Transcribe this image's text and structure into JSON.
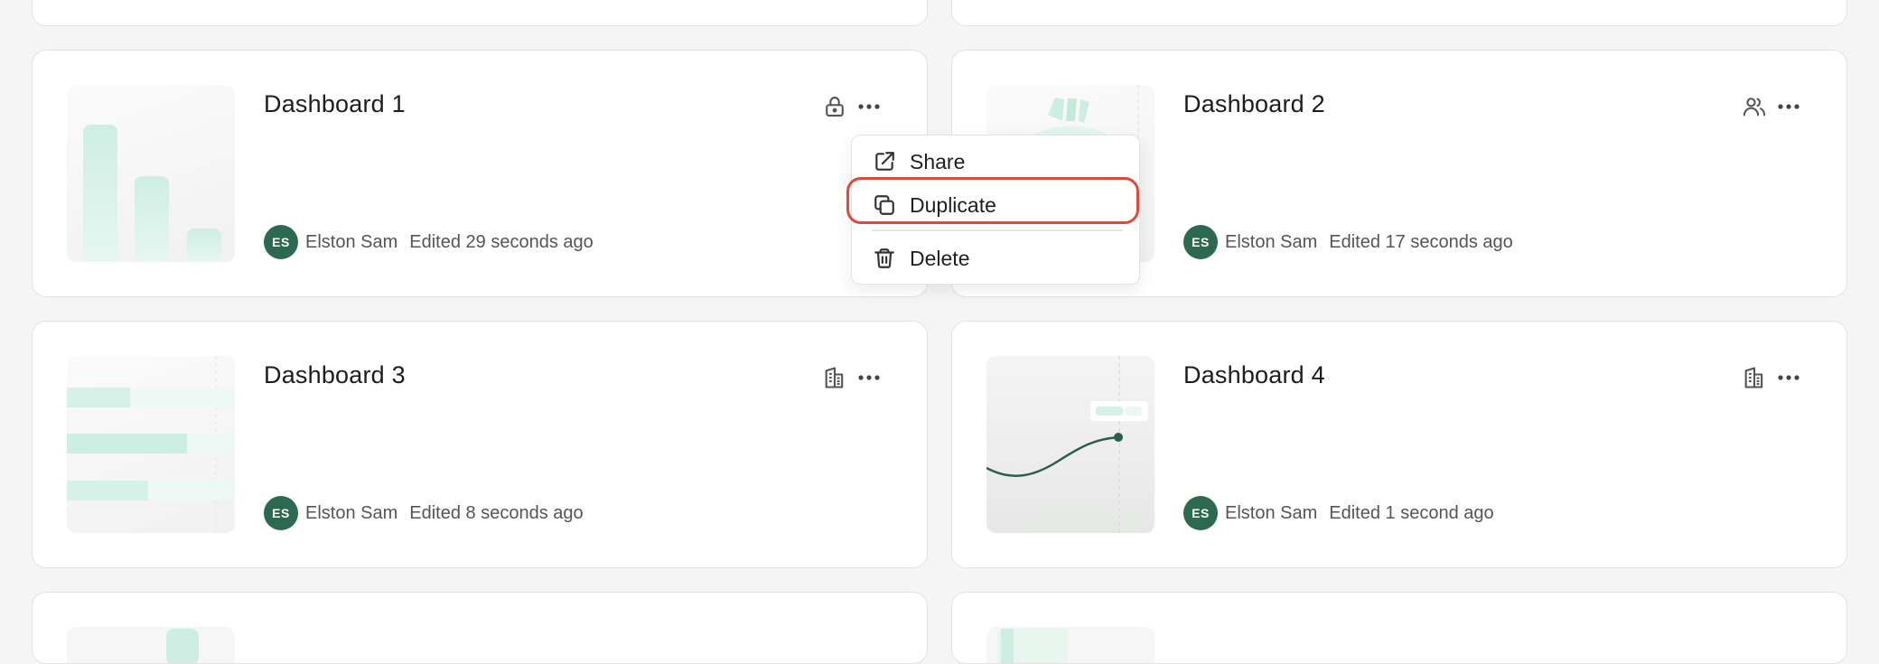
{
  "cards": [
    {
      "title": "Dashboard 1",
      "avatar_initials": "ES",
      "owner": "Elston Sam",
      "edited": "Edited 29 seconds ago",
      "status_icon": "lock-icon"
    },
    {
      "title": "Dashboard 2",
      "avatar_initials": "ES",
      "owner": "Elston Sam",
      "edited": "Edited 17 seconds ago",
      "status_icon": "users-icon"
    },
    {
      "title": "Dashboard 3",
      "avatar_initials": "ES",
      "owner": "Elston Sam",
      "edited": "Edited 8 seconds ago",
      "status_icon": "building-icon"
    },
    {
      "title": "Dashboard 4",
      "avatar_initials": "ES",
      "owner": "Elston Sam",
      "edited": "Edited 1 second ago",
      "status_icon": "building-icon"
    }
  ],
  "menu": {
    "items": [
      {
        "label": "Share",
        "icon": "external-link-icon"
      },
      {
        "label": "Duplicate",
        "icon": "copy-icon",
        "highlighted": true
      },
      {
        "label": "Delete",
        "icon": "trash-icon"
      }
    ]
  },
  "colors": {
    "accent": "#2b6a50",
    "highlight": "#e0483a",
    "thumb_mint": "#cdeee2"
  }
}
